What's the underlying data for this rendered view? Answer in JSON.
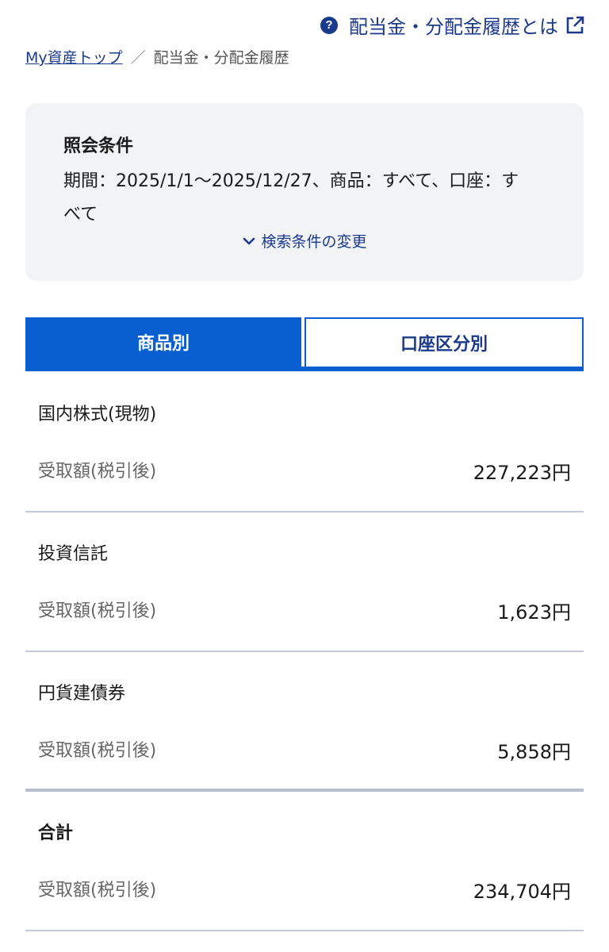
{
  "header": {
    "help_icon_glyph": "?",
    "help_link_label": "配当金・分配金履歴とは"
  },
  "breadcrumb": {
    "home_label": "My資産トップ",
    "separator": "／",
    "current_label": "配当金・分配金履歴"
  },
  "conditions": {
    "title": "照会条件",
    "text": "期間：2025/1/1〜2025/12/27、商品：すべて、口座：すべて",
    "change_label": "検索条件の変更"
  },
  "tabs": [
    {
      "label": "商品別",
      "active": true
    },
    {
      "label": "口座区分別",
      "active": false
    }
  ],
  "rows": [
    {
      "title": "国内株式(現物)",
      "label": "受取額(税引後)",
      "value": "227,223円"
    },
    {
      "title": "投資信託",
      "label": "受取額(税引後)",
      "value": "1,623円"
    },
    {
      "title": "円貨建債券",
      "label": "受取額(税引後)",
      "value": "5,858円"
    },
    {
      "title": "合計",
      "label": "受取額(税引後)",
      "value": "234,704円"
    }
  ],
  "icons": {
    "help": "help-circle-icon",
    "external": "external-link-icon",
    "chevron": "chevron-down-icon"
  },
  "colors": {
    "accent": "#0a5fd0",
    "link": "#1b3a8c",
    "panel_bg": "#f2f3f5"
  }
}
